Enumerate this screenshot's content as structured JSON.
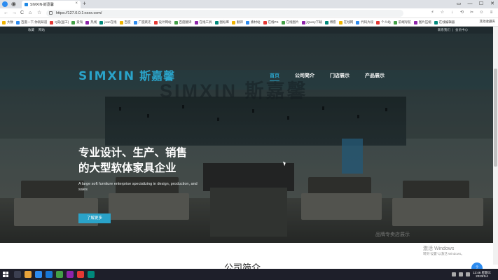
{
  "browser": {
    "tab_title": "SIMXIN-斯嘉馨",
    "tab_close": "×",
    "new_tab": "+",
    "url": "https://127.0.0.1:xxxx.com/",
    "window_controls": [
      "▭",
      "—",
      "☐",
      "✕"
    ]
  },
  "nav_buttons": [
    "←",
    "→",
    "C",
    "⌂",
    "☆"
  ],
  "bookmarks": [
    "大数",
    "百度一下,你就知道",
    "Q奕(国工)",
    "爱淘",
    "热线",
    "json在线",
    "百度",
    "广度跃迁",
    "设计网站",
    "百度翻译",
    "在线工具",
    "图标库",
    "翻译",
    "素材站",
    "在线PS",
    "在线图片",
    "jQuery下载",
    "博客",
    "在线网",
    "代码片段",
    "个人站",
    "前端导航",
    "图片压缩",
    "在线编辑器"
  ],
  "bookmarks_more": "其他收藏夹",
  "site": {
    "topbar_left": [
      "收藏",
      "网站"
    ],
    "topbar_right": [
      "联系我们",
      "|",
      "会员中心"
    ],
    "logo_en": "SIMXIN",
    "logo_cn": "斯嘉馨",
    "nav": [
      "首页",
      "公司简介",
      "门店展示",
      "产品展示"
    ],
    "hero_title_line1": "专业设计、生产、销售",
    "hero_title_line2": "的大型软体家具企业",
    "hero_subtitle": "A large soft furniture enterprise specializing in design, production, and sales",
    "hero_button": "了解更多",
    "hero_watermark": "品牌专卖店展示",
    "section_title": "公司简介"
  },
  "overlay": {
    "activate_title": "激活 Windows",
    "activate_sub": "转到\"设置\"以激活 Windows。",
    "chat_icon": "?"
  },
  "taskbar": {
    "time": "12:46 星期三",
    "date": "2023/1/4"
  },
  "colors": {
    "accent": "#2aa3c9",
    "topbar": "#1f2a2e",
    "taskbar": "#1e1f2a"
  }
}
